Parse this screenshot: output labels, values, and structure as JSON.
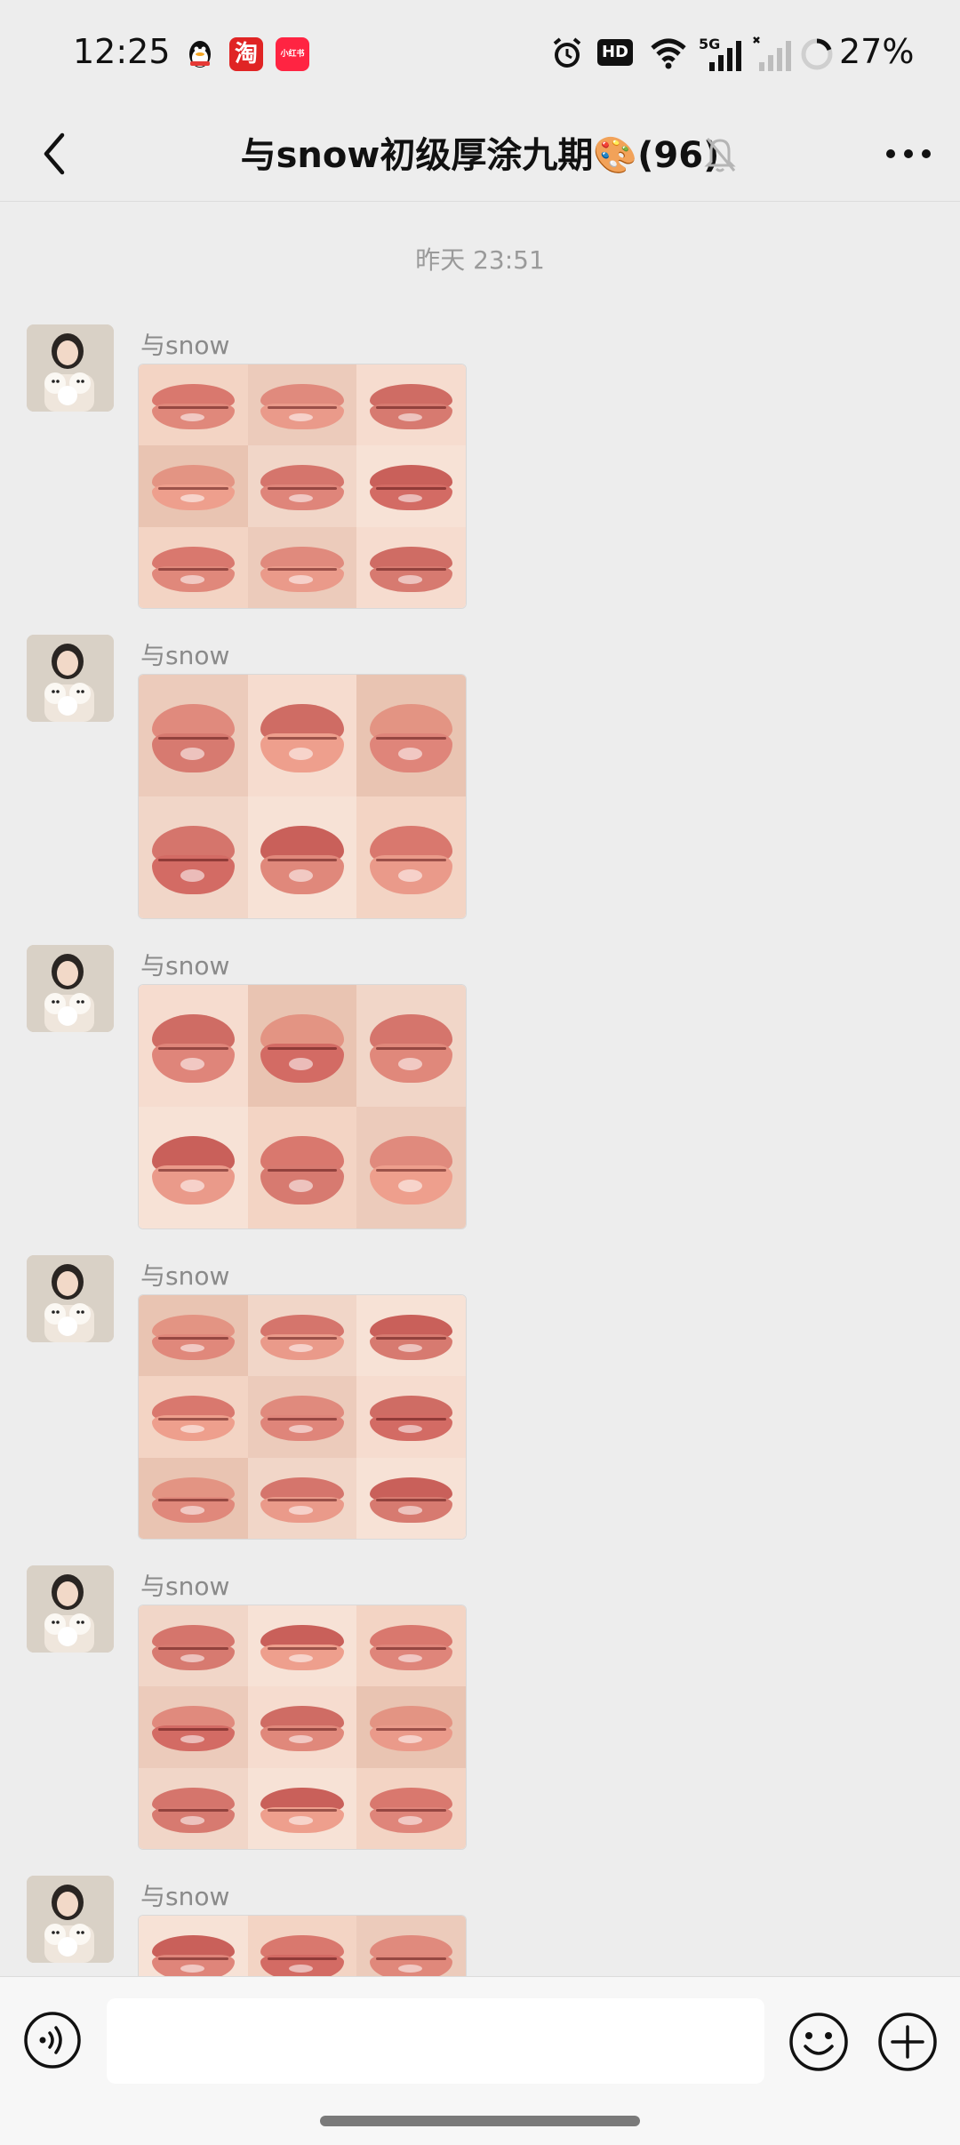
{
  "status_bar": {
    "time": "12:25",
    "notification_icons": [
      "qq-icon",
      "taobao-icon",
      "xiaohongshu-icon"
    ],
    "taobao_glyph": "淘",
    "xiaohongshu_label": "小红书",
    "status_icons": [
      "alarm-icon",
      "hd-icon",
      "wifi-icon",
      "5g-signal-icon",
      "signal-icon",
      "battery-icon"
    ],
    "hd_label": "HD",
    "network_label": "5G",
    "battery": "27%"
  },
  "nav": {
    "title": "与snow初级厚涂九期🎨(96)"
  },
  "chat": {
    "timestamp": "昨天 23:51",
    "messages": [
      {
        "sender": "与snow",
        "rows": 3
      },
      {
        "sender": "与snow",
        "rows": 2
      },
      {
        "sender": "与snow",
        "rows": 2
      },
      {
        "sender": "与snow",
        "rows": 3
      },
      {
        "sender": "与snow",
        "rows": 3
      },
      {
        "sender": "与snow",
        "rows": 3
      }
    ]
  },
  "input": {
    "placeholder": ""
  },
  "colors": {
    "background": "#ededed",
    "input_bar": "#f7f7f7"
  }
}
